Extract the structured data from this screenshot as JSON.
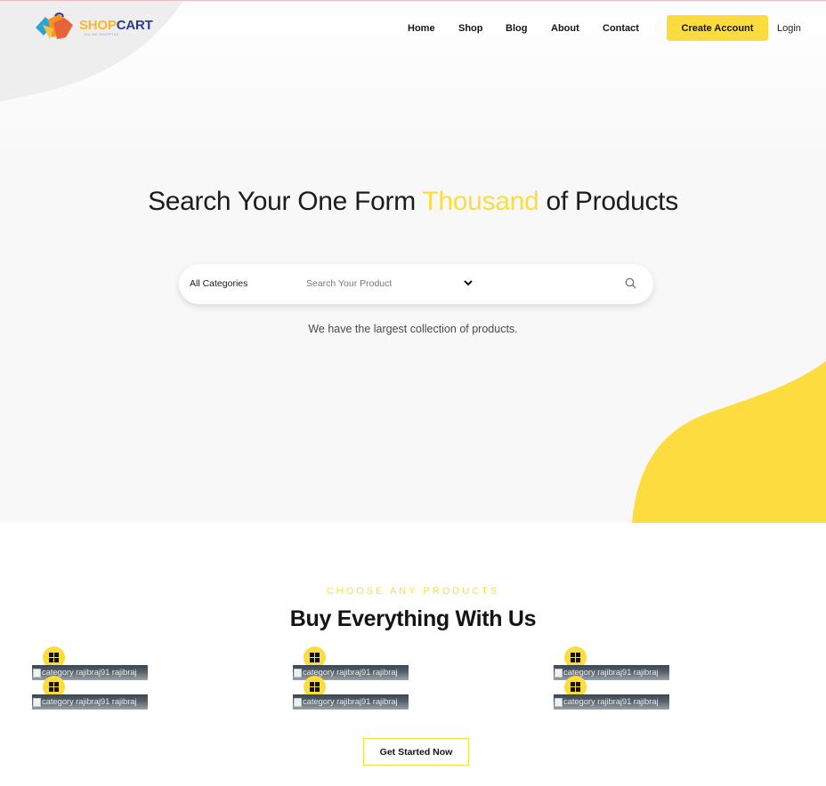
{
  "brand": {
    "name_part1": "SHOP",
    "name_part2": "CART",
    "tagline": "ONLINE SHOPPING",
    "colors": {
      "accent": "#fddc3f",
      "logo_blue": "#2f3a8f",
      "logo_orange": "#f7b731"
    }
  },
  "header": {
    "nav": [
      "Home",
      "Shop",
      "Blog",
      "About",
      "Contact"
    ],
    "create_account": "Create Account",
    "login": "Login"
  },
  "hero": {
    "headline_before": "Search Your One Form ",
    "headline_accent": "Thousand",
    "headline_after": " of Products",
    "category_selected": "All Categories",
    "search_placeholder": "Search Your Product",
    "subtext": "We have the largest collection of products."
  },
  "categories_section": {
    "eyebrow": "CHOOSE ANY PRODUCTS",
    "title": "Buy Everything With Us",
    "items": [
      {
        "alt": "category rajibraj91 rajibraj",
        "icon": "windows-icon"
      },
      {
        "alt": "category rajibraj91 rajibraj",
        "icon": "windows-icon"
      },
      {
        "alt": "category rajibraj91 rajibraj",
        "icon": "windows-icon"
      },
      {
        "alt": "category rajibraj91 rajibraj",
        "icon": "windows-icon"
      },
      {
        "alt": "category rajibraj91 rajibraj",
        "icon": "windows-icon"
      },
      {
        "alt": "category rajibraj91 rajibraj",
        "icon": "windows-icon"
      }
    ],
    "cta": "Get Started Now"
  }
}
